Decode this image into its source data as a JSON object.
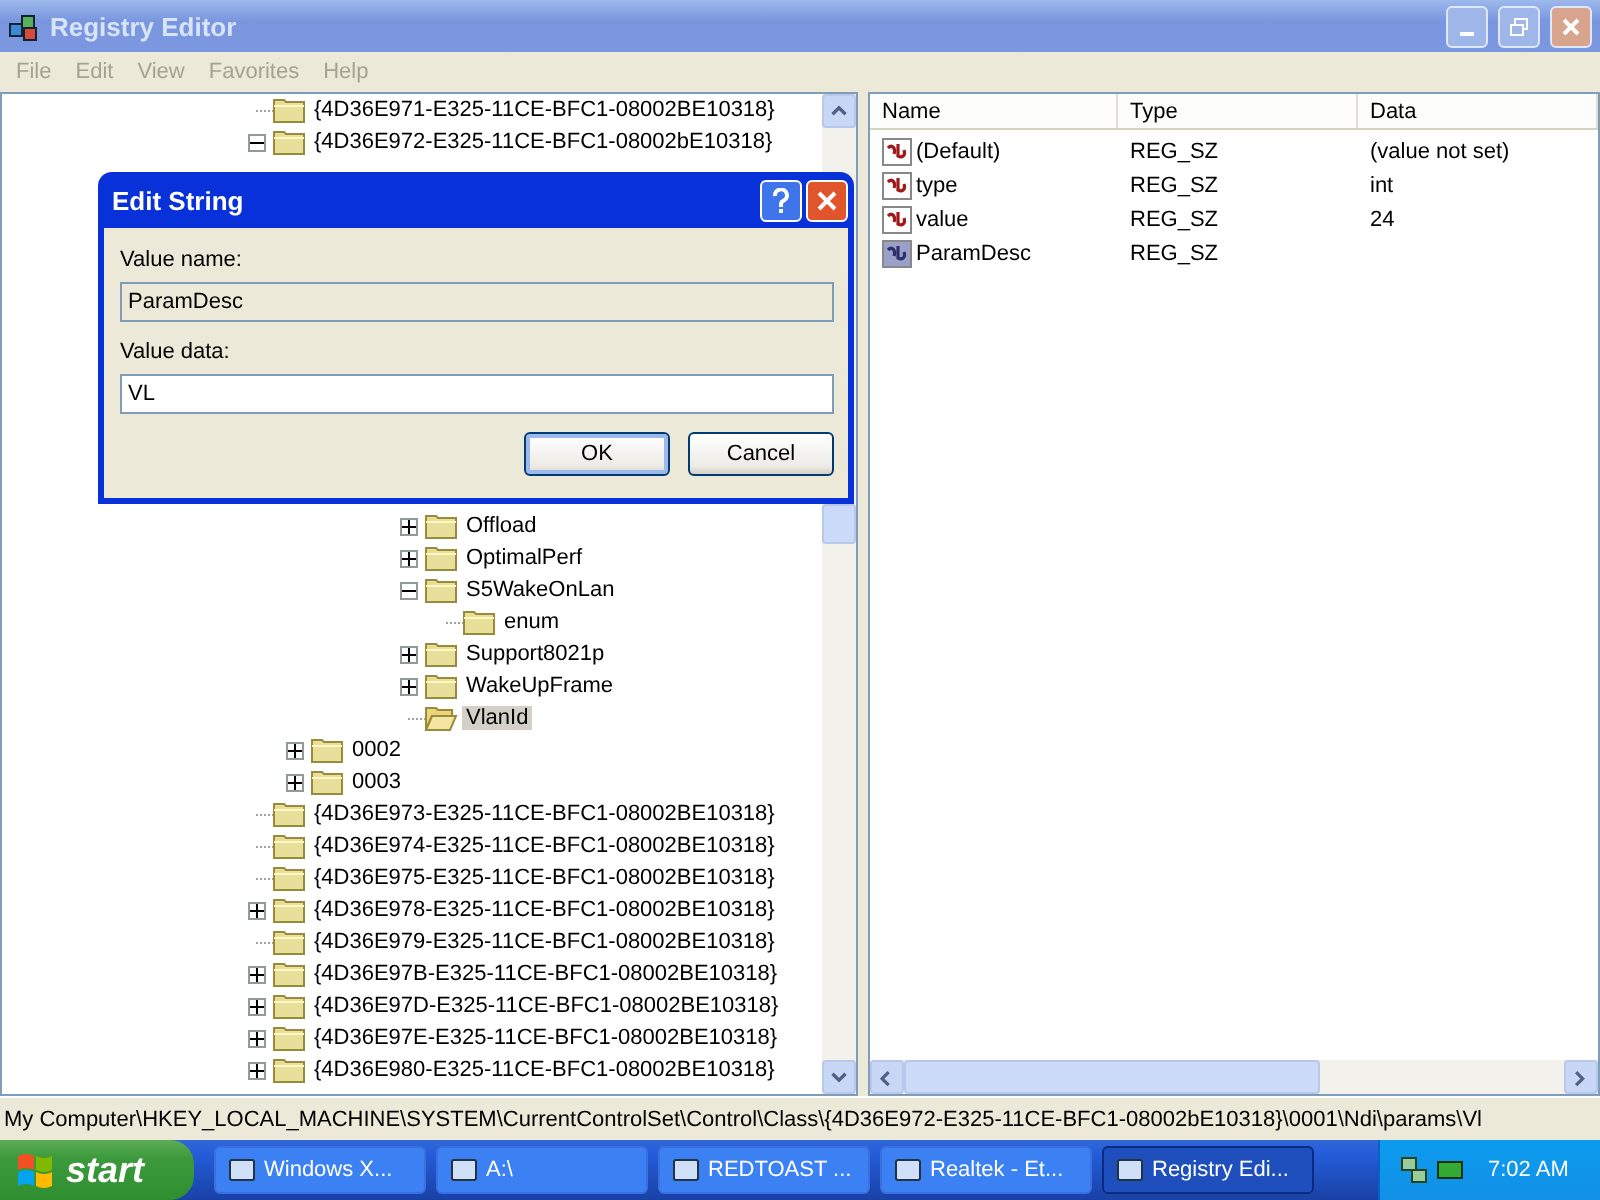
{
  "window": {
    "title": "Registry Editor"
  },
  "menu": [
    {
      "label": "File",
      "disabled": true
    },
    {
      "label": "Edit",
      "disabled": true
    },
    {
      "label": "View",
      "disabled": true
    },
    {
      "label": "Favorites",
      "disabled": true
    },
    {
      "label": "Help",
      "disabled": true
    }
  ],
  "tree": [
    {
      "label": "{4D36E971-E325-11CE-BFC1-08002BE10318}",
      "selected": false
    },
    {
      "label": "{4D36E972-E325-11CE-BFC1-08002bE10318}",
      "selected": false,
      "expanded": true,
      "children": [
        {
          "children": [
            {
              "children": [
                {
                  "children": [
                    {
                      "label": "Offload",
                      "selected": false,
                      "expanded": false
                    },
                    {
                      "label": "OptimalPerf",
                      "selected": false,
                      "expanded": false
                    },
                    {
                      "label": "S5WakeOnLan",
                      "selected": false,
                      "expanded": true,
                      "children": [
                        {
                          "label": "enum",
                          "selected": false
                        }
                      ]
                    },
                    {
                      "label": "Support8021p",
                      "selected": false,
                      "expanded": false
                    },
                    {
                      "label": "WakeUpFrame",
                      "selected": false,
                      "expanded": false
                    },
                    {
                      "label": "VlanId",
                      "selected": true
                    }
                  ]
                }
              ]
            }
          ]
        },
        {
          "label": "0002",
          "selected": false,
          "expanded": false
        },
        {
          "label": "0003",
          "selected": false,
          "expanded": false
        }
      ]
    },
    {
      "label": "{4D36E973-E325-11CE-BFC1-08002BE10318}",
      "selected": false
    },
    {
      "label": "{4D36E974-E325-11CE-BFC1-08002BE10318}",
      "selected": false
    },
    {
      "label": "{4D36E975-E325-11CE-BFC1-08002BE10318}",
      "selected": false
    },
    {
      "label": "{4D36E978-E325-11CE-BFC1-08002BE10318}",
      "selected": false,
      "expanded": false
    },
    {
      "label": "{4D36E979-E325-11CE-BFC1-08002BE10318}",
      "selected": false
    },
    {
      "label": "{4D36E97B-E325-11CE-BFC1-08002BE10318}",
      "selected": false,
      "expanded": false
    },
    {
      "label": "{4D36E97D-E325-11CE-BFC1-08002BE10318}",
      "selected": false,
      "expanded": false
    },
    {
      "label": "{4D36E97E-E325-11CE-BFC1-08002BE10318}",
      "selected": false,
      "expanded": false
    },
    {
      "label": "{4D36E980-E325-11CE-BFC1-08002BE10318}",
      "selected": false,
      "expanded": false
    }
  ],
  "list": {
    "columns": [
      "Name",
      "Type",
      "Data"
    ],
    "rows": [
      {
        "name": "(Default)",
        "type": "REG_SZ",
        "data": "(value not set)",
        "selected": false
      },
      {
        "name": "type",
        "type": "REG_SZ",
        "data": "int",
        "selected": false
      },
      {
        "name": "value",
        "type": "REG_SZ",
        "data": "24",
        "selected": false
      },
      {
        "name": "ParamDesc",
        "type": "REG_SZ",
        "selected": true
      }
    ]
  },
  "status_bar": "My Computer\\HKEY_LOCAL_MACHINE\\SYSTEM\\CurrentControlSet\\Control\\Class\\{4D36E972-E325-11CE-BFC1-08002bE10318}\\0001\\Ndi\\params\\Vl",
  "dialog": {
    "title": "Edit String",
    "value_name_label": "Value name:",
    "value_name": "ParamDesc",
    "value_data_label": "Value data:",
    "value_data": "VL",
    "buttons": [
      {
        "label": "OK",
        "default": true
      },
      {
        "label": "Cancel",
        "default": false
      }
    ]
  },
  "taskbar": {
    "start": "start",
    "items": [
      {
        "label": "Windows X...",
        "selected": false
      },
      {
        "label": "A:\\",
        "selected": false
      },
      {
        "label": "REDTOAST ...",
        "selected": false
      },
      {
        "label": "Realtek - Et...",
        "selected": false
      },
      {
        "label": "Registry Edi...",
        "selected": true
      }
    ],
    "clock": "7:02 AM"
  }
}
